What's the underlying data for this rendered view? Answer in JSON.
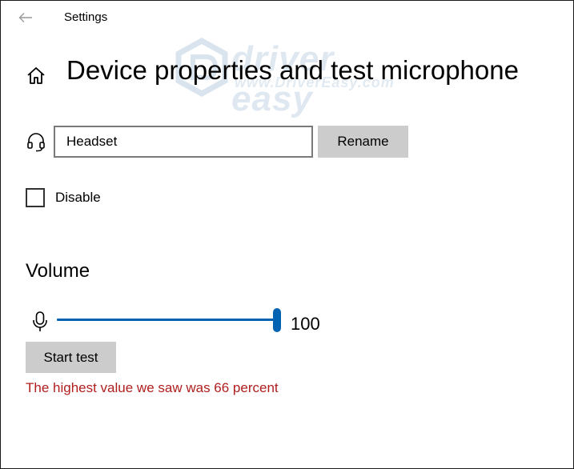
{
  "app": {
    "title": "Settings"
  },
  "page": {
    "title": "Device properties and test microphone"
  },
  "watermark": {
    "brand": "driver easy",
    "url": "www.DriverEasy.com"
  },
  "device": {
    "name_value": "Headset",
    "rename_label": "Rename",
    "disable_label": "Disable",
    "disabled": false
  },
  "volume": {
    "section_title": "Volume",
    "level": 100,
    "level_text": "100",
    "max": 100,
    "start_test_label": "Start test",
    "result_text": "The highest value we saw was 66 percent"
  },
  "icons": {
    "back": "back-arrow-icon",
    "home": "home-icon",
    "device": "headset-icon",
    "volume": "microphone-icon"
  },
  "colors": {
    "accent": "#0063b1",
    "button_bg": "#cccccc",
    "error_text": "#b01e1e",
    "back_arrow": "#9a9a9a"
  }
}
